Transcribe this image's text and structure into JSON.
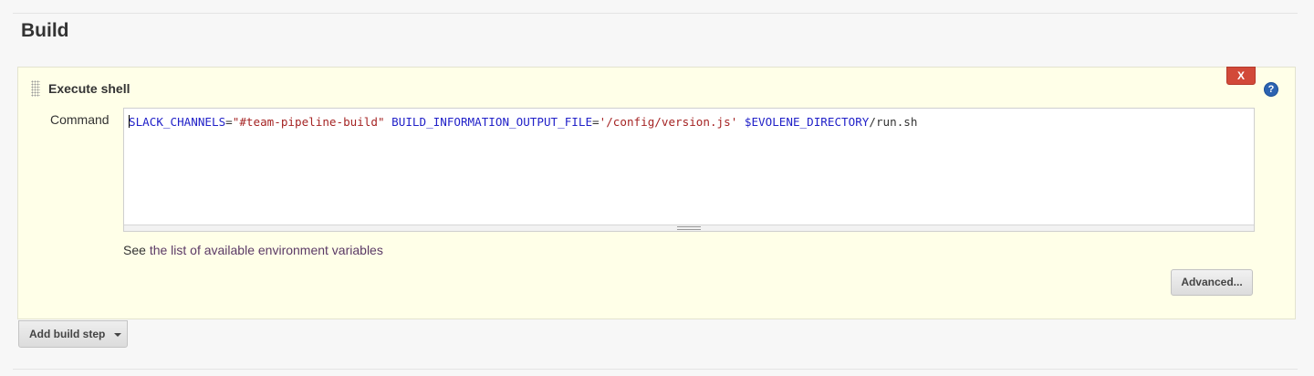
{
  "section": {
    "title": "Build"
  },
  "step": {
    "title": "Execute shell",
    "delete_label": "X",
    "help_label": "?",
    "command_label": "Command",
    "command_tokens": {
      "t1": "SLACK_CHANNELS",
      "t2": "=",
      "t3": "\"#team-pipeline-build\"",
      "t4": " ",
      "t5": "BUILD_INFORMATION_OUTPUT_FILE",
      "t6": "=",
      "t7": "'/config/version.js'",
      "t8": " ",
      "t9": "$EVOLENE_DIRECTORY",
      "t10": "/run.sh"
    },
    "help_prefix": "See ",
    "help_link": "the list of available environment variables",
    "advanced_label": "Advanced..."
  },
  "add_step": {
    "label": "Add build step"
  },
  "colors": {
    "panel_bg": "#ffffe8",
    "delete_bg": "#d24939",
    "help_icon_bg": "#2c63b1",
    "code_variable": "#2121c8",
    "code_string": "#a52424",
    "link": "#5b3a66"
  }
}
